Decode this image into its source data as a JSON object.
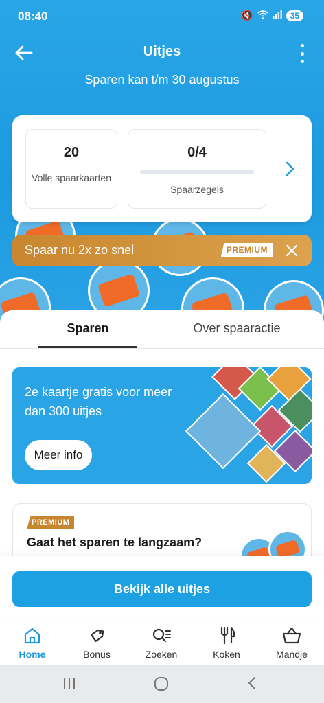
{
  "status_bar": {
    "time": "08:40",
    "battery": "35"
  },
  "header": {
    "title": "Uitjes",
    "subtitle": "Sparen kan t/m 30 augustus"
  },
  "stats": {
    "full_cards_value": "20",
    "full_cards_label": "Volle spaarkaarten",
    "stamps_value": "0/4",
    "stamps_label": "Spaarzegels",
    "stamps_progress": 0
  },
  "premium_banner": {
    "text": "Spaar nu 2x zo snel",
    "badge": "PREMIUM"
  },
  "tabs": [
    {
      "label": "Sparen",
      "active": true
    },
    {
      "label": "Over spaaractie",
      "active": false
    }
  ],
  "promo": {
    "text": "2e kaartje gratis voor meer dan 300 uitjes",
    "button": "Meer info"
  },
  "premium_card": {
    "badge": "PREMIUM",
    "title": "Gaat het sparen te langzaam?"
  },
  "cta": {
    "label": "Bekijk alle uitjes"
  },
  "bottom_nav": [
    {
      "label": "Home",
      "icon": "home-icon",
      "active": true
    },
    {
      "label": "Bonus",
      "icon": "tag-icon",
      "active": false
    },
    {
      "label": "Zoeken",
      "icon": "search-icon",
      "active": false
    },
    {
      "label": "Koken",
      "icon": "cutlery-icon",
      "active": false
    },
    {
      "label": "Mandje",
      "icon": "basket-icon",
      "active": false
    }
  ],
  "colors": {
    "primary": "#1d9ae0",
    "premium": "#c6862f",
    "promo_orange": "#f06a28"
  }
}
